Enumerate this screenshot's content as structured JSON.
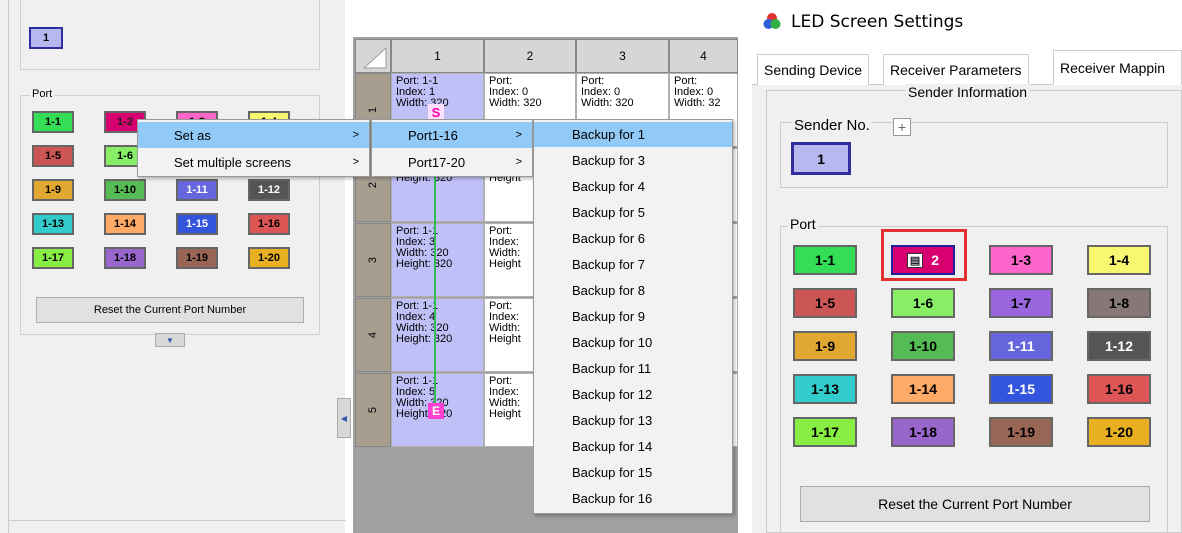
{
  "left": {
    "sender_no": "1",
    "port_label": "Port",
    "ports": [
      {
        "label": "1-1",
        "color": "#33dd55"
      },
      {
        "label": "1-2",
        "color": "#d80070"
      },
      {
        "label": "1-3",
        "color": "#ff66cc"
      },
      {
        "label": "1-4",
        "color": "#f8f870"
      },
      {
        "label": "1-5",
        "color": "#cc5555"
      },
      {
        "label": "1-6",
        "color": "#88ee66"
      },
      {
        "label": "1-7",
        "color": "#9966dd"
      },
      {
        "label": "1-8",
        "color": "#887777"
      },
      {
        "label": "1-9",
        "color": "#e0a830"
      },
      {
        "label": "1-10",
        "color": "#55bb55"
      },
      {
        "label": "1-11",
        "color": "#6666dd"
      },
      {
        "label": "1-12",
        "color": "#555555"
      },
      {
        "label": "1-13",
        "color": "#33cccc"
      },
      {
        "label": "1-14",
        "color": "#ffaa66"
      },
      {
        "label": "1-15",
        "color": "#3355dd"
      },
      {
        "label": "1-16",
        "color": "#dd5555"
      },
      {
        "label": "1-17",
        "color": "#88ee44"
      },
      {
        "label": "1-18",
        "color": "#9966cc"
      },
      {
        "label": "1-19",
        "color": "#996655"
      },
      {
        "label": "1-20",
        "color": "#e8b020"
      }
    ],
    "reset_label": "Reset the Current Port Number"
  },
  "grid": {
    "columns": [
      "1",
      "2",
      "3",
      "4"
    ],
    "rows": [
      "1",
      "2",
      "3",
      "4",
      "5"
    ],
    "cells": [
      [
        "Port: 1-1\nIndex: 1\nWidth: 320",
        "Port:\nIndex: 0\nWidth: 320",
        "Port:\nIndex: 0\nWidth: 320",
        "Port:\nIndex: 0\nWidth: 32"
      ],
      [
        "Index: 2\nWidth: 320\nHeight: 320",
        "Index:\nWidth:\nHeight",
        "",
        ""
      ],
      [
        "Port: 1-1\nIndex: 3\nWidth: 320\nHeight: 320",
        "Port:\nIndex:\nWidth:\nHeight",
        "",
        ""
      ],
      [
        "Port: 1-1\nIndex: 4\nWidth: 320\nHeight: 320",
        "Port:\nIndex:\nWidth:\nHeight",
        "",
        ""
      ],
      [
        "Port: 1-1\nIndex: 5\nWidth: 320\nHeight: 320",
        "Port:\nIndex:\nWidth:\nHeight",
        "",
        ""
      ]
    ],
    "start_marker": "S",
    "end_marker": "E"
  },
  "menu1": [
    "Set as",
    "Set multiple screens"
  ],
  "menu2": [
    "Port1-16",
    "Port17-20"
  ],
  "menu3": [
    "Backup for 1",
    "Backup for 3",
    "Backup for 4",
    "Backup for 5",
    "Backup for 6",
    "Backup for 7",
    "Backup for 8",
    "Backup for 9",
    "Backup for 10",
    "Backup for 11",
    "Backup for 12",
    "Backup for 13",
    "Backup for 14",
    "Backup for 15",
    "Backup for 16"
  ],
  "window": {
    "title": "LED Screen Settings",
    "tabs": [
      "Sending Device",
      "Receiver Parameters",
      "Receiver Mappin"
    ],
    "sender_information": "Sender Information",
    "sender_no_label": "Sender No.",
    "plus": "+",
    "sender_no": "1",
    "port_label": "Port",
    "selected_port_number": "2",
    "reset_label": "Reset the Current Port Number"
  }
}
